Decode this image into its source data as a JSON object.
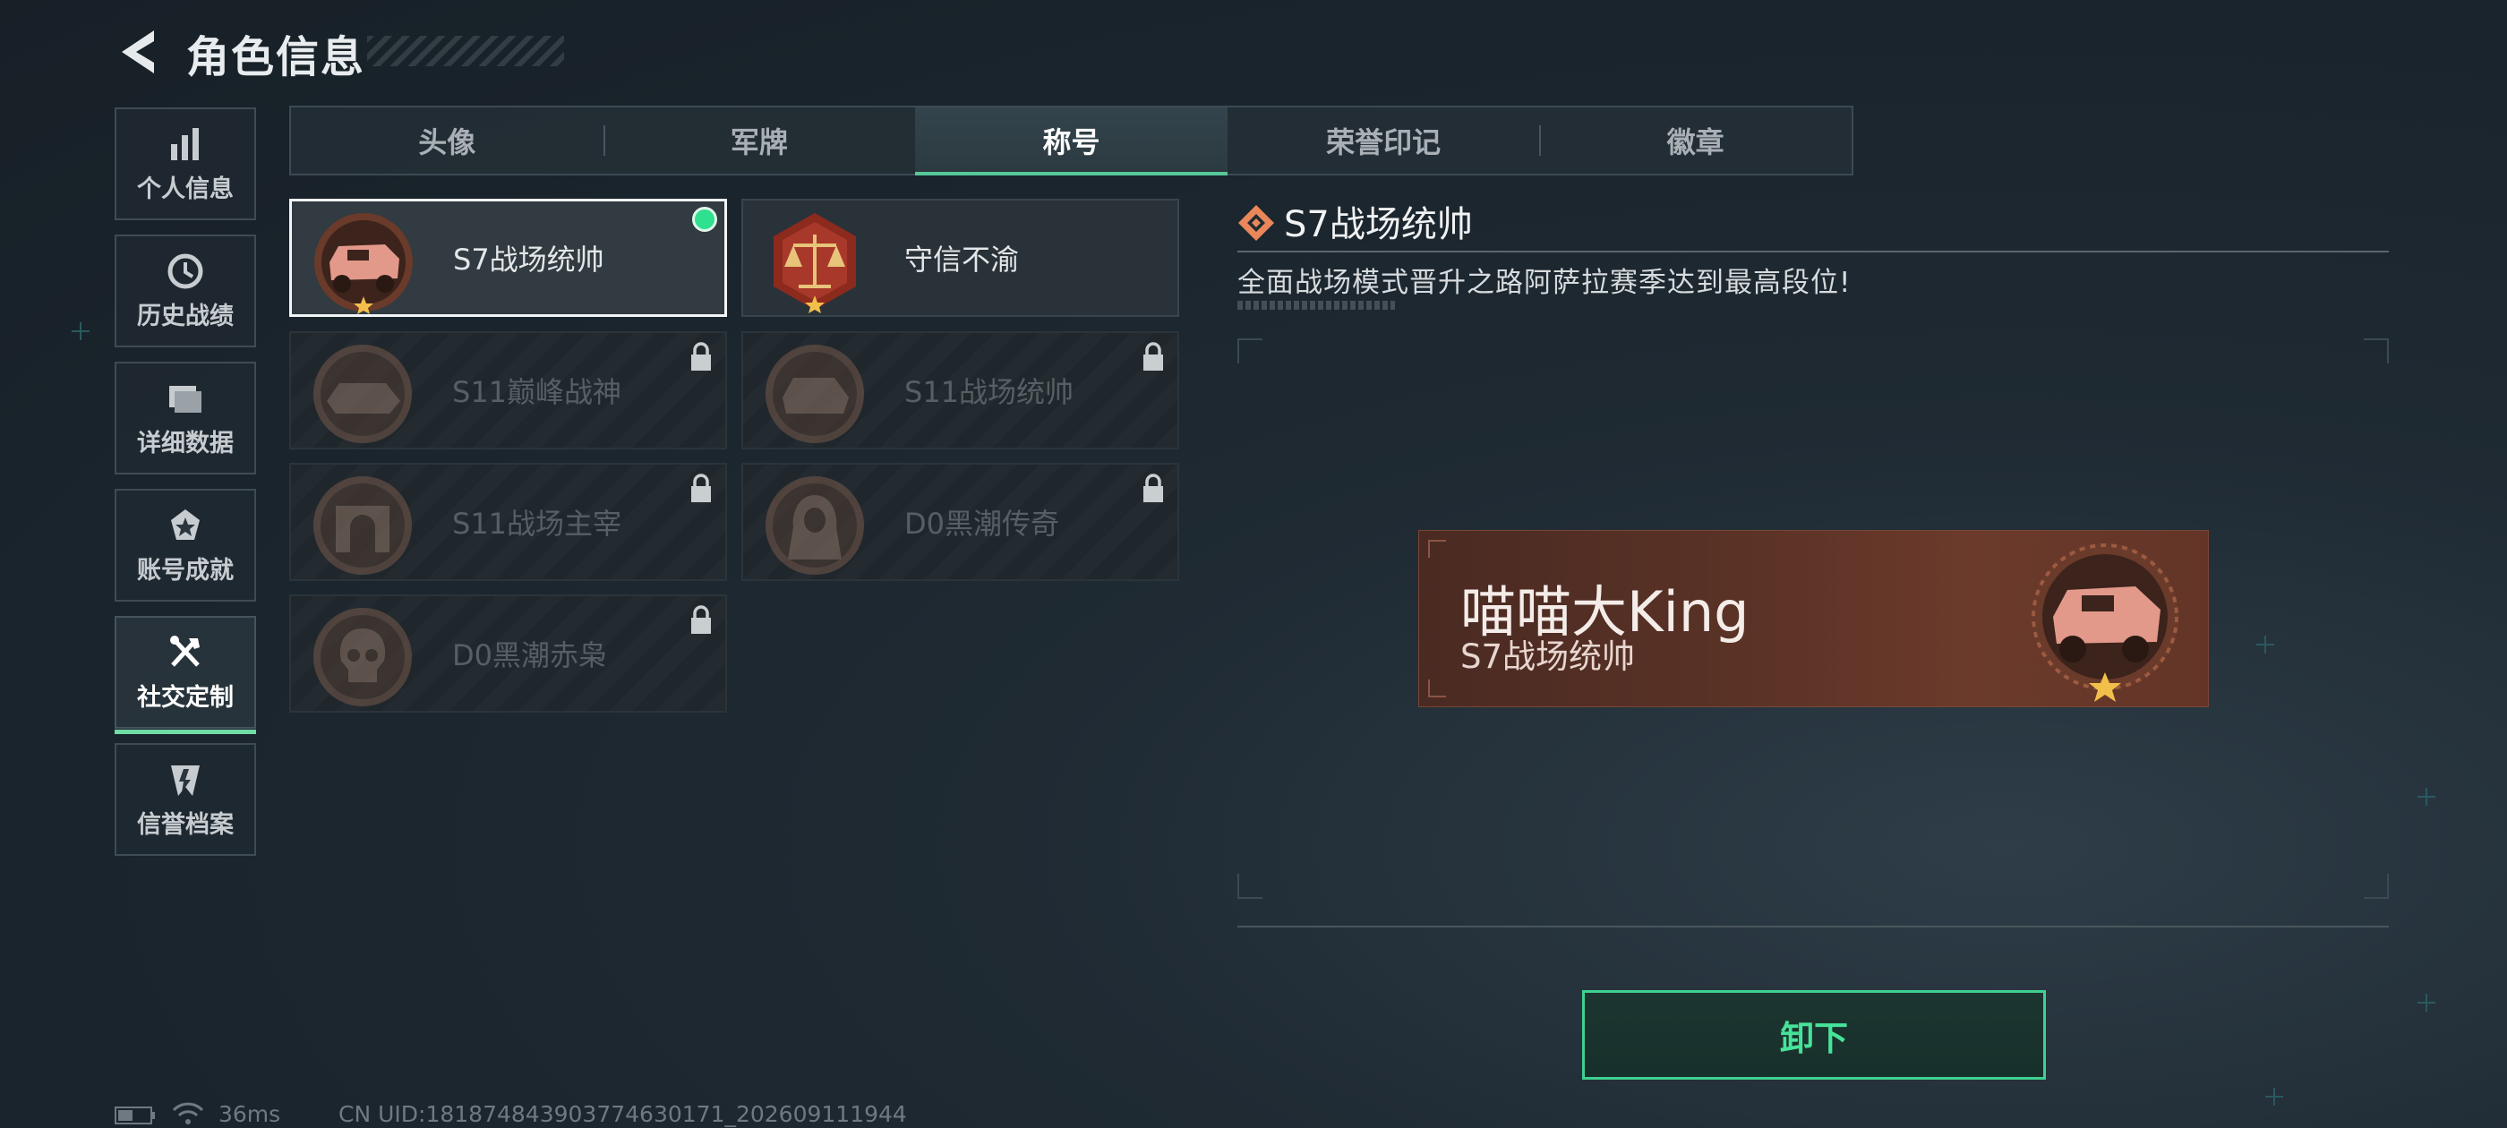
{
  "header": {
    "title": "角色信息"
  },
  "sidebar": {
    "items": [
      {
        "label": "个人信息",
        "icon": "bar-chart-icon",
        "active": false
      },
      {
        "label": "历史战绩",
        "icon": "clock-icon",
        "active": false
      },
      {
        "label": "详细数据",
        "icon": "folder-icon",
        "active": false
      },
      {
        "label": "账号成就",
        "icon": "medal-icon",
        "active": false
      },
      {
        "label": "社交定制",
        "icon": "tools-icon",
        "active": true
      },
      {
        "label": "信誉档案",
        "icon": "shield-icon",
        "active": false
      }
    ]
  },
  "tabs": [
    {
      "label": "头像",
      "active": false
    },
    {
      "label": "军牌",
      "active": false
    },
    {
      "label": "称号",
      "active": true
    },
    {
      "label": "荣誉印记",
      "active": false
    },
    {
      "label": "徽章",
      "active": false
    }
  ],
  "titles": [
    {
      "name": "S7战场统帅",
      "badge": "armored-vehicle-badge-icon",
      "locked": false,
      "selected": true,
      "equipped": true
    },
    {
      "name": "守信不渝",
      "badge": "scales-badge-icon",
      "locked": false,
      "selected": false,
      "equipped": false
    },
    {
      "name": "S11巅峰战神",
      "badge": "hovercraft-badge-icon",
      "locked": true,
      "selected": false,
      "equipped": false
    },
    {
      "name": "S11战场统帅",
      "badge": "tank-badge-icon",
      "locked": true,
      "selected": false,
      "equipped": false
    },
    {
      "name": "S11战场主宰",
      "badge": "arch-badge-icon",
      "locked": true,
      "selected": false,
      "equipped": false
    },
    {
      "name": "D0黑潮传奇",
      "badge": "hooded-figure-badge-icon",
      "locked": true,
      "selected": false,
      "equipped": false
    },
    {
      "name": "D0黑潮赤枭",
      "badge": "skull-badge-icon",
      "locked": true,
      "selected": false,
      "equipped": false
    }
  ],
  "detail": {
    "title": "S7战场统帅",
    "description": "全面战场模式晋升之路阿萨拉赛季达到最高段位!"
  },
  "nameplate": {
    "player_name": "喵喵大King",
    "title": "S7战场统帅"
  },
  "actions": {
    "unequip_label": "卸下"
  },
  "status": {
    "ping": "36ms",
    "uid": "CN UID:181874843903774630171_202609111944"
  },
  "colors": {
    "accent_green": "#3fd190",
    "nameplate_bg": "#5a3226",
    "badge_copper": "#c9876a"
  }
}
